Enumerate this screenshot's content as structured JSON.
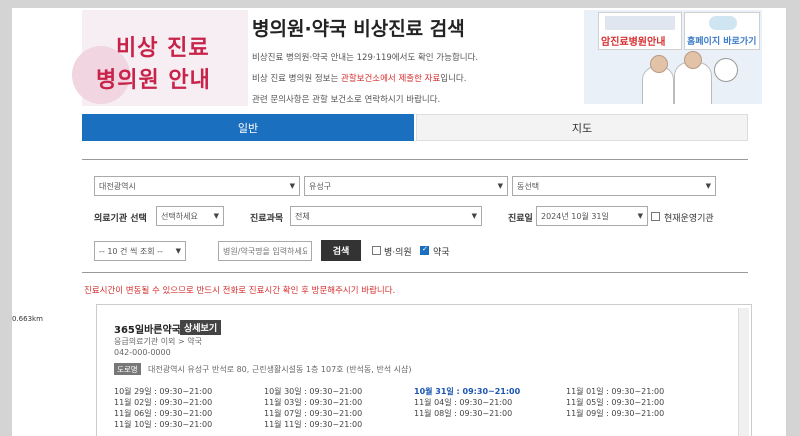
{
  "header": {
    "logo_line1": "비상 진료",
    "logo_line2": "병의원 안내",
    "title": "병의원·약국 비상진료 검색",
    "info_line1": "비상진료 병의원·약국 안내는 129·119에서도 확인 가능합니다.",
    "info_line2_before": "비상 진료 병의원 정보는 ",
    "info_line2_red": "관할보건소에서 제출한 자료",
    "info_line2_after": "입니다.",
    "info_line3": "관련 문의사항은 관할 보건소로 연락하시기 바랍니다.",
    "banner_link1": "암진료병원안내",
    "banner_link2": "홈페이지 바로가기"
  },
  "tabs": [
    {
      "label": "일반",
      "active": true
    },
    {
      "label": "지도",
      "active": false
    }
  ],
  "search": {
    "city": "대전광역시",
    "district": "유성구",
    "dong": "동선택",
    "institution_label": "의료기관 선택",
    "institution_value": "선택하세요",
    "dept_label": "진료과목",
    "dept_value": "전체",
    "date_label": "진료일",
    "date_value": "2024년 10월 31일",
    "open_now_label": "현재운영기관",
    "page_size": "-- 10 건 씩 조회 --",
    "keyword_placeholder": "병원/약국명을 입력하세요",
    "search_button": "검색",
    "filter_hospital": "병·의원",
    "filter_pharmacy": "약국",
    "filter_hospital_checked": false,
    "filter_pharmacy_checked": true
  },
  "notice": "진료시간이 변동될 수 있으므로 반드시 전화로 진료시간 확인 후 방문해주시기 바랍니다.",
  "result": {
    "distance": "0.663km",
    "name": "365일바른약국",
    "detail_button": "상세보기",
    "category": "응급의료기관 이외 > 약국",
    "phone": "042-000-0000",
    "road_badge": "도로명",
    "address": "대전광역시 유성구 반석로 80, 근린생활시설동 1층 107호 (반석동, 반석 시샵)",
    "hours": [
      [
        "10월 29일 : 09:30~21:00",
        "10월 30일 : 09:30~21:00",
        "10월 31일 : 09:30~21:00",
        "11월 01일 : 09:30~21:00"
      ],
      [
        "11월 02일 : 09:30~21:00",
        "11월 03일 : 09:30~21:00",
        "11월 04일 : 09:30~21:00",
        "11월 05일 : 09:30~21:00"
      ],
      [
        "11월 06일 : 09:30~21:00",
        "11월 07일 : 09:30~21:00",
        "11월 08일 : 09:30~21:00",
        "11월 09일 : 09:30~21:00"
      ],
      [
        "11월 10일 : 09:30~21:00",
        "11월 11일 : 09:30~21:00",
        "",
        ""
      ]
    ],
    "today_label": "10월 31일"
  },
  "colors": {
    "primary": "#1a6fbf",
    "accent_red": "#d6302f",
    "logo_pink": "#c8234a"
  }
}
